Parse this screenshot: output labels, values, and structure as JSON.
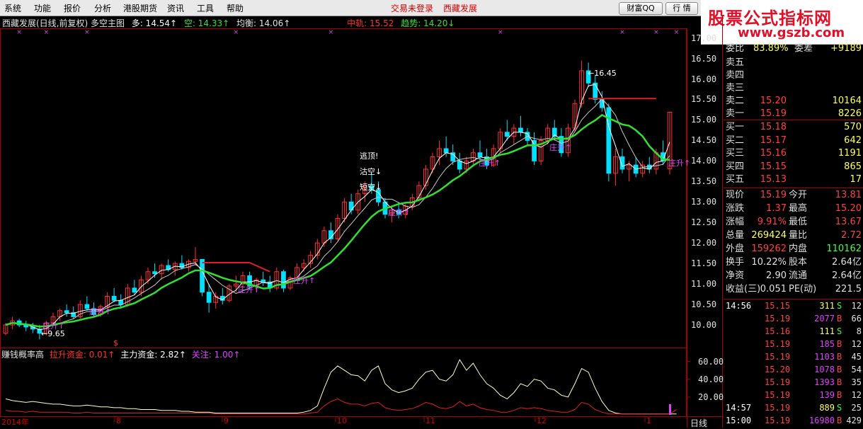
{
  "menu": {
    "items": [
      "系统",
      "功能",
      "报价",
      "分析",
      "港股期货",
      "资讯",
      "工具",
      "帮助"
    ],
    "status_login": "交易未登录",
    "status_stock": "西藏发展",
    "btn_qq": "财富QQ",
    "btn_quote": "行 情",
    "btn_win": [
      "🗕",
      "🗗",
      "✕"
    ]
  },
  "logo": {
    "line1": "股票公式指标网",
    "line2": "www.gszb.com"
  },
  "info": {
    "title": "西藏发展(日线,前复权) 多空主图",
    "duo": "多: 14.54↑",
    "kong": "空: 14.33↑",
    "junheng": "均衡: 14.06↑",
    "zhonggui": "中轨: 15.52",
    "qushi": "趋势: 14.20↓"
  },
  "price_axis": [
    "17.00",
    "16.50",
    "16.00",
    "15.50",
    "15.00",
    "14.50",
    "14.00",
    "13.50",
    "13.00",
    "12.50",
    "12.00",
    "11.50",
    "11.00",
    "10.50",
    "10.00"
  ],
  "indicator_axis": [
    "60.00",
    "40.00",
    "20.00"
  ],
  "dates": [
    "2014年",
    "8",
    "9",
    "10",
    "11",
    "12",
    "1"
  ],
  "period_label": "日线",
  "annotations": {
    "high": "16.45",
    "low": "9.65",
    "taoding": "逃顶!",
    "jiekong": "沽空↓",
    "duankong": "短空↓",
    "zhusheng": "庄升↑",
    "dollar": "$"
  },
  "indicator_info": {
    "name": "赚钱概率高",
    "laszj": "拉升资金: 0.01↑",
    "zlzj": "主力资金: 2.82↑",
    "guanzhu": "关注: 1.00↑"
  },
  "panel": {
    "weibi_label": "委比",
    "weibi_val": "83.89%",
    "weicha_label": "委差",
    "weicha_val": "+9189",
    "asks": [
      {
        "label": "卖五",
        "price": "",
        "vol": ""
      },
      {
        "label": "卖四",
        "price": "",
        "vol": ""
      },
      {
        "label": "卖三",
        "price": "",
        "vol": ""
      },
      {
        "label": "卖二",
        "price": "15.20",
        "vol": "10164"
      },
      {
        "label": "卖一",
        "price": "15.19",
        "vol": "8226"
      }
    ],
    "bids": [
      {
        "label": "买一",
        "price": "15.18",
        "vol": "570"
      },
      {
        "label": "买二",
        "price": "15.17",
        "vol": "642"
      },
      {
        "label": "买三",
        "price": "15.16",
        "vol": "1191"
      },
      {
        "label": "买四",
        "price": "15.15",
        "vol": "865"
      },
      {
        "label": "买五",
        "price": "15.13",
        "vol": "17"
      }
    ],
    "stats": [
      {
        "l1": "现价",
        "v1": "15.19",
        "l2": "今开",
        "v2": "13.81",
        "c1": "#ff4040",
        "c2": "#ff4040"
      },
      {
        "l1": "涨跌",
        "v1": "1.37",
        "l2": "最高",
        "v2": "15.20",
        "c1": "#ff4040",
        "c2": "#ff4040"
      },
      {
        "l1": "涨幅",
        "v1": "9.91%",
        "l2": "最低",
        "v2": "13.67",
        "c1": "#ff4040",
        "c2": "#ff4040"
      },
      {
        "l1": "总量",
        "v1": "269424",
        "l2": "量比",
        "v2": "2.72",
        "c1": "#ffff60",
        "c2": "#ff4040"
      },
      {
        "l1": "外盘",
        "v1": "159262",
        "l2": "内盘",
        "v2": "110162",
        "c1": "#ff4040",
        "c2": "#40ff40"
      },
      {
        "l1": "换手",
        "v1": "10.22%",
        "l2": "股本",
        "v2": "2.64亿",
        "c1": "#e0e0e0",
        "c2": "#e0e0e0"
      },
      {
        "l1": "净资",
        "v1": "2.90",
        "l2": "流通",
        "v2": "2.64亿",
        "c1": "#e0e0e0",
        "c2": "#e0e0e0"
      },
      {
        "l1": "收益(三)",
        "v1": "0.051",
        "l2": "PE(动)",
        "v2": "221.5",
        "c1": "#e0e0e0",
        "c2": "#e0e0e0"
      }
    ],
    "ticks": [
      {
        "t": "14:56",
        "p": "15.15",
        "v": "311",
        "bs": "S",
        "n": "12"
      },
      {
        "t": "",
        "p": "15.19",
        "v": "2077",
        "bs": "B",
        "n": "66"
      },
      {
        "t": "",
        "p": "15.16",
        "v": "111",
        "bs": "S",
        "n": "8"
      },
      {
        "t": "",
        "p": "15.19",
        "v": "185",
        "bs": "B",
        "n": "12"
      },
      {
        "t": "",
        "p": "15.19",
        "v": "1103",
        "bs": "B",
        "n": "45"
      },
      {
        "t": "",
        "p": "15.20",
        "v": "1078",
        "bs": "B",
        "n": "54"
      },
      {
        "t": "",
        "p": "15.19",
        "v": "1393",
        "bs": "B",
        "n": "35"
      },
      {
        "t": "",
        "p": "15.19",
        "v": "139",
        "bs": "B",
        "n": "12"
      },
      {
        "t": "14:57",
        "p": "15.19",
        "v": "889",
        "bs": "S",
        "n": "25"
      },
      {
        "t": "15:00",
        "p": "15.19",
        "v": "16980",
        "bs": "B",
        "n": "429"
      }
    ]
  },
  "colors": {
    "up": "#ff3030",
    "down": "#00e0ff",
    "green": "#30e030",
    "white": "#ffffff",
    "yellow": "#ffff50",
    "purple": "#e040ff",
    "axis": "#a00000"
  },
  "chart_data": {
    "type": "candlestick",
    "ylim": [
      9.5,
      17.2
    ],
    "ohlc": [
      [
        9.8,
        10.05,
        9.75,
        10.0
      ],
      [
        10.0,
        10.2,
        9.9,
        10.1
      ],
      [
        10.1,
        10.15,
        9.95,
        10.0
      ],
      [
        10.0,
        10.1,
        9.85,
        9.95
      ],
      [
        9.95,
        10.05,
        9.8,
        9.9
      ],
      [
        9.9,
        10.0,
        9.65,
        9.8
      ],
      [
        9.8,
        10.1,
        9.75,
        10.05
      ],
      [
        10.05,
        10.3,
        10.0,
        10.2
      ],
      [
        10.2,
        10.4,
        10.1,
        10.35
      ],
      [
        10.35,
        10.5,
        10.2,
        10.3
      ],
      [
        10.3,
        10.45,
        10.15,
        10.2
      ],
      [
        10.2,
        10.6,
        10.15,
        10.5
      ],
      [
        10.5,
        10.7,
        10.35,
        10.4
      ],
      [
        10.4,
        10.55,
        10.2,
        10.25
      ],
      [
        10.25,
        10.5,
        10.2,
        10.45
      ],
      [
        10.45,
        10.8,
        10.4,
        10.7
      ],
      [
        10.7,
        10.9,
        10.55,
        10.6
      ],
      [
        10.6,
        10.75,
        10.4,
        10.5
      ],
      [
        10.5,
        11.0,
        10.45,
        10.9
      ],
      [
        10.9,
        11.1,
        10.75,
        10.8
      ],
      [
        10.8,
        11.2,
        10.7,
        11.1
      ],
      [
        11.1,
        11.4,
        11.0,
        11.3
      ],
      [
        11.3,
        11.5,
        11.15,
        11.25
      ],
      [
        11.25,
        11.5,
        11.1,
        11.45
      ],
      [
        11.45,
        11.6,
        11.3,
        11.35
      ],
      [
        11.35,
        11.55,
        11.2,
        11.5
      ],
      [
        11.5,
        11.7,
        11.35,
        11.4
      ],
      [
        11.4,
        11.6,
        11.3,
        11.55
      ],
      [
        11.55,
        11.9,
        11.45,
        11.6
      ],
      [
        11.6,
        11.6,
        10.7,
        10.8
      ],
      [
        10.8,
        11.0,
        10.3,
        10.55
      ],
      [
        10.55,
        10.8,
        10.4,
        10.7
      ],
      [
        10.7,
        10.9,
        10.5,
        10.6
      ],
      [
        10.6,
        11.0,
        10.55,
        10.95
      ],
      [
        10.95,
        11.2,
        10.8,
        11.0
      ],
      [
        11.0,
        11.3,
        10.9,
        11.2
      ],
      [
        11.2,
        11.3,
        10.85,
        10.95
      ],
      [
        10.95,
        11.15,
        10.8,
        11.1
      ],
      [
        11.1,
        11.3,
        10.95,
        11.05
      ],
      [
        11.05,
        11.2,
        10.8,
        10.9
      ],
      [
        10.9,
        11.4,
        10.85,
        11.3
      ],
      [
        11.3,
        11.35,
        10.8,
        10.9
      ],
      [
        10.9,
        11.2,
        10.85,
        11.15
      ],
      [
        11.15,
        11.5,
        11.1,
        11.4
      ],
      [
        11.4,
        11.6,
        11.3,
        11.5
      ],
      [
        11.5,
        11.8,
        11.4,
        11.7
      ],
      [
        11.7,
        12.1,
        11.6,
        12.0
      ],
      [
        12.0,
        12.4,
        11.9,
        12.3
      ],
      [
        12.3,
        12.5,
        12.0,
        12.1
      ],
      [
        12.1,
        12.7,
        12.05,
        12.6
      ],
      [
        12.6,
        13.1,
        12.5,
        13.0
      ],
      [
        13.0,
        13.2,
        12.7,
        12.8
      ],
      [
        12.8,
        13.3,
        12.7,
        13.2
      ],
      [
        13.2,
        13.5,
        13.0,
        13.4
      ],
      [
        13.4,
        13.7,
        13.2,
        13.3
      ],
      [
        13.3,
        13.5,
        12.9,
        13.0
      ],
      [
        13.0,
        13.1,
        12.6,
        12.7
      ],
      [
        12.7,
        12.9,
        12.5,
        12.8
      ],
      [
        12.8,
        13.0,
        12.6,
        12.7
      ],
      [
        12.7,
        12.95,
        12.6,
        12.9
      ],
      [
        12.9,
        13.2,
        12.8,
        13.1
      ],
      [
        13.1,
        13.5,
        13.0,
        13.4
      ],
      [
        13.4,
        13.9,
        13.3,
        13.8
      ],
      [
        13.8,
        14.2,
        13.7,
        14.1
      ],
      [
        14.1,
        14.5,
        13.9,
        14.3
      ],
      [
        14.3,
        14.6,
        14.1,
        14.2
      ],
      [
        14.2,
        14.4,
        13.9,
        14.0
      ],
      [
        14.0,
        14.2,
        13.7,
        13.8
      ],
      [
        13.8,
        14.1,
        13.7,
        14.0
      ],
      [
        14.0,
        14.3,
        13.9,
        14.2
      ],
      [
        14.2,
        14.5,
        14.0,
        14.1
      ],
      [
        14.1,
        14.3,
        13.8,
        13.9
      ],
      [
        13.9,
        14.4,
        13.85,
        14.3
      ],
      [
        14.3,
        14.8,
        14.2,
        14.7
      ],
      [
        14.7,
        15.0,
        14.5,
        14.6
      ],
      [
        14.6,
        14.9,
        14.4,
        14.8
      ],
      [
        14.8,
        15.1,
        14.6,
        14.7
      ],
      [
        14.7,
        14.8,
        14.4,
        14.5
      ],
      [
        14.5,
        14.7,
        13.9,
        14.0
      ],
      [
        14.0,
        14.6,
        13.9,
        14.5
      ],
      [
        14.5,
        14.9,
        14.4,
        14.8
      ],
      [
        14.8,
        15.0,
        14.5,
        14.6
      ],
      [
        14.6,
        14.8,
        14.1,
        14.2
      ],
      [
        14.2,
        14.9,
        14.1,
        14.8
      ],
      [
        14.8,
        15.5,
        14.7,
        15.4
      ],
      [
        15.4,
        16.45,
        15.3,
        16.2
      ],
      [
        16.2,
        16.4,
        15.8,
        15.9
      ],
      [
        15.9,
        16.1,
        15.4,
        15.5
      ],
      [
        15.5,
        15.7,
        15.2,
        15.3
      ],
      [
        15.3,
        15.4,
        13.5,
        13.7
      ],
      [
        13.7,
        14.3,
        13.4,
        14.1
      ],
      [
        14.1,
        14.3,
        13.7,
        13.8
      ],
      [
        13.8,
        14.0,
        13.5,
        13.9
      ],
      [
        13.9,
        14.1,
        13.6,
        13.7
      ],
      [
        13.7,
        14.0,
        13.6,
        13.9
      ],
      [
        13.9,
        14.1,
        13.7,
        13.8
      ],
      [
        13.8,
        14.3,
        13.67,
        14.2
      ],
      [
        14.2,
        14.5,
        13.9,
        14.0
      ],
      [
        13.81,
        15.2,
        13.67,
        15.19
      ]
    ],
    "indicator": {
      "ylim": [
        0,
        70
      ],
      "white": [
        18,
        16,
        15,
        14,
        15,
        14,
        13,
        12,
        12,
        11,
        10,
        10,
        11,
        10,
        9,
        9,
        8,
        8,
        7,
        7,
        6,
        6,
        6,
        5,
        5,
        5,
        4,
        4,
        3,
        3,
        3,
        2,
        2,
        2,
        2,
        2,
        2,
        2,
        2,
        2,
        2,
        2,
        2,
        2,
        3,
        5,
        10,
        30,
        48,
        55,
        50,
        45,
        44,
        38,
        50,
        55,
        35,
        28,
        25,
        27,
        30,
        40,
        48,
        50,
        40,
        38,
        45,
        62,
        50,
        58,
        45,
        35,
        30,
        22,
        18,
        25,
        35,
        32,
        40,
        38,
        30,
        28,
        22,
        20,
        35,
        52,
        48,
        30,
        15,
        5,
        2,
        1,
        1,
        1,
        1,
        1,
        1,
        1,
        1,
        1
      ],
      "red": [
        5,
        4,
        4,
        3,
        4,
        3,
        3,
        3,
        3,
        3,
        2,
        2,
        3,
        2,
        2,
        2,
        2,
        2,
        2,
        2,
        2,
        2,
        2,
        2,
        2,
        2,
        2,
        2,
        2,
        2,
        2,
        1,
        1,
        1,
        1,
        1,
        1,
        1,
        1,
        1,
        1,
        1,
        1,
        1,
        1,
        2,
        3,
        10,
        15,
        18,
        14,
        12,
        12,
        10,
        13,
        14,
        8,
        6,
        5,
        6,
        7,
        10,
        14,
        12,
        8,
        7,
        9,
        15,
        10,
        12,
        8,
        6,
        5,
        3,
        3,
        5,
        8,
        7,
        8,
        7,
        5,
        4,
        3,
        3,
        6,
        14,
        12,
        6,
        3,
        1,
        1,
        1,
        1,
        1,
        1,
        1,
        1,
        1,
        1,
        6
      ]
    }
  }
}
